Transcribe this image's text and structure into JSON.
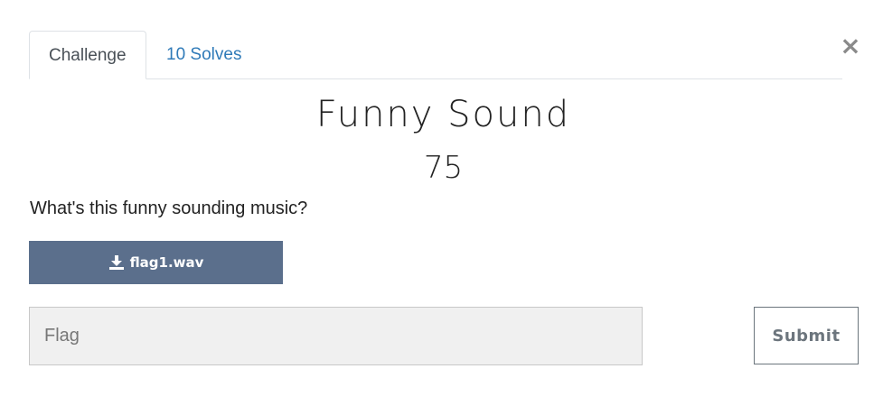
{
  "modal": {
    "close_symbol": "×",
    "tabs": [
      {
        "label": "Challenge",
        "active": true
      },
      {
        "label": "10 Solves",
        "active": false
      }
    ],
    "challenge": {
      "title": "Funny Sound",
      "points": "75",
      "description": "What's this funny sounding music?"
    },
    "file": {
      "icon": "download-icon",
      "label": "flag1.wav"
    },
    "flag": {
      "value": "",
      "placeholder": "Flag"
    },
    "submit_label": "Submit"
  },
  "colors": {
    "file_button_bg": "#5b6f8c",
    "tab_link": "#2f7ab8",
    "input_bg": "#f0f0f0",
    "submit_border": "#6c757d"
  }
}
